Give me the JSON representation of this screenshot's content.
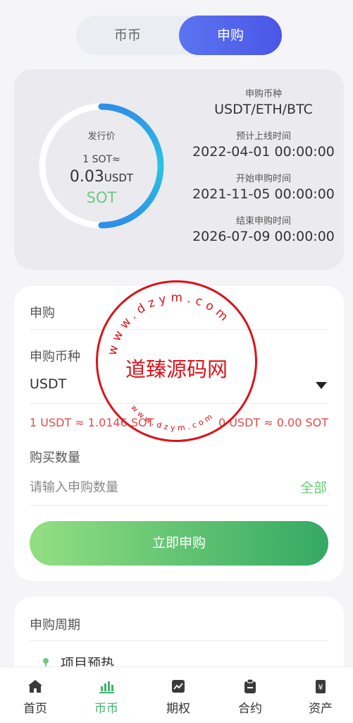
{
  "segment": {
    "options": [
      "币币",
      "申购"
    ],
    "active": "申购"
  },
  "summary": {
    "issue_price_label": "发行价",
    "rate_line": "1 SOT≈",
    "price_value": "0.03",
    "price_unit": "USDT",
    "token": "SOT",
    "currencies_label": "申购币种",
    "currencies_value": "USDT/ETH/BTC",
    "launch_label": "预计上线时间",
    "launch_value": "2022-04-01 00:00:00",
    "start_label": "开始申购时间",
    "start_value": "2021-11-05 00:00:00",
    "end_label": "结束申购时间",
    "end_value": "2026-07-09 00:00:00",
    "progress_fraction": 0.5
  },
  "form": {
    "title": "申购",
    "currency_label": "申购币种",
    "currency_value": "USDT",
    "rate_left": "1 USDT ≈ 1.0146 SOT",
    "rate_right": "0 USDT ≈ 0.00 SOT",
    "quantity_label": "购买数量",
    "quantity_placeholder": "请输入申购数量",
    "all_label": "全部",
    "submit_label": "立即申购"
  },
  "period": {
    "title": "申购周期",
    "first_step": "项目预热"
  },
  "watermark": {
    "text": "道臻源码网",
    "ring_text": "www.dzym.com"
  },
  "tabbar": {
    "items": [
      {
        "label": "首页",
        "icon": "home-icon"
      },
      {
        "label": "币币",
        "icon": "bar-chart-icon"
      },
      {
        "label": "期权",
        "icon": "trend-icon"
      },
      {
        "label": "合约",
        "icon": "contract-icon"
      },
      {
        "label": "资产",
        "icon": "wallet-icon"
      }
    ],
    "active_index": 1,
    "active_color": "#3fb36a"
  }
}
